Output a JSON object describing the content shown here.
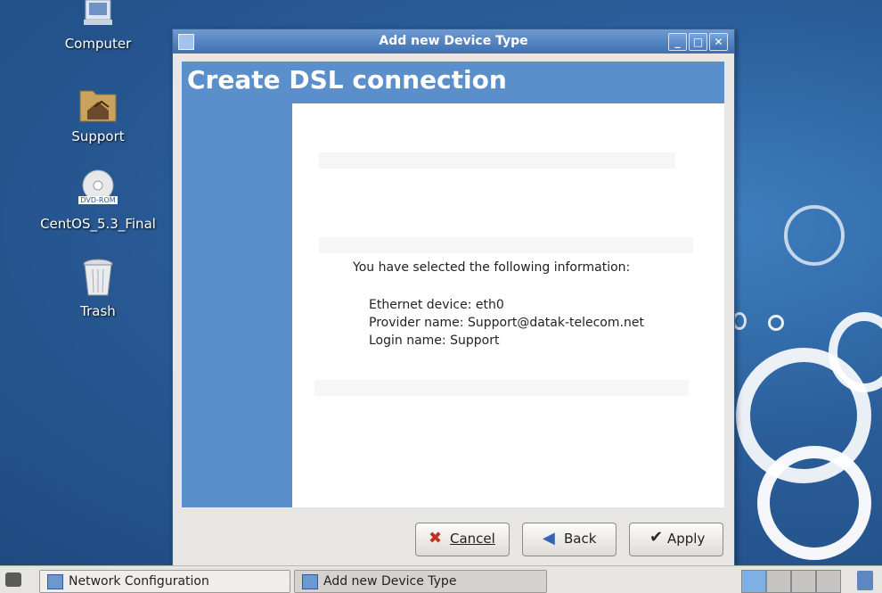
{
  "desktop": {
    "icons": [
      {
        "label": "Computer",
        "icon": "computer-icon"
      },
      {
        "label": "Support",
        "icon": "folder-home-icon"
      },
      {
        "label": "CentOS_5.3_Final",
        "icon": "dvd-icon",
        "badge": "DVD-ROM"
      },
      {
        "label": "Trash",
        "icon": "trash-icon"
      }
    ]
  },
  "dialog": {
    "title": "Add new Device Type",
    "header": "Create DSL connection",
    "summary_heading": "You have selected the following information:",
    "fields": [
      {
        "label": "Ethernet device:",
        "value": "eth0"
      },
      {
        "label": "Provider name:",
        "value": "Support@datak-telecom.net"
      },
      {
        "label": "Login name:",
        "value": "Support"
      }
    ],
    "buttons": {
      "cancel": "Cancel",
      "back": "Back",
      "apply": "Apply"
    }
  },
  "taskbar": {
    "tasks": [
      {
        "label": "Network Configuration"
      },
      {
        "label": "Add new Device Type"
      }
    ]
  },
  "colors": {
    "desktop": "#2a5d99",
    "dialog_header": "#5b8fcc",
    "titlebar": "#3e6fb0"
  }
}
